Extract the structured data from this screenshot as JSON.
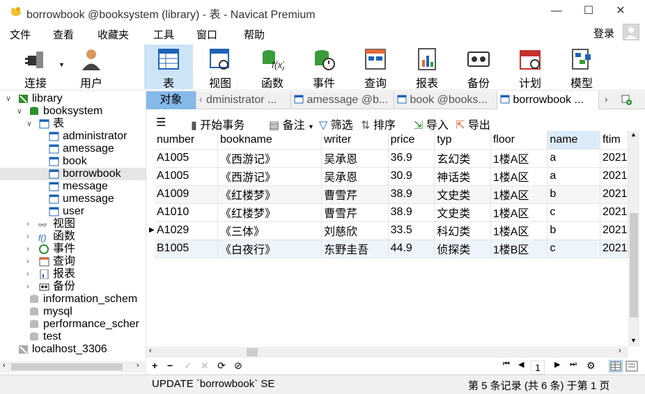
{
  "window": {
    "title": "borrowbook @booksystem (library) - 表 - Navicat Premium",
    "minimize": "—",
    "maximize": "☐",
    "close": "✕"
  },
  "menu": [
    "文件",
    "查看",
    "收藏夹",
    "工具",
    "窗口",
    "帮助"
  ],
  "login": "登录",
  "toolbar": [
    "连接",
    "用户",
    "表",
    "视图",
    "函数",
    "事件",
    "查询",
    "报表",
    "备份",
    "计划",
    "模型"
  ],
  "tree": {
    "connection": "library",
    "database": "booksystem",
    "tables_folder": "表",
    "tables": [
      "administrator",
      "amessage",
      "book",
      "borrowbook",
      "message",
      "umessage",
      "user"
    ],
    "folders": [
      "视图",
      "函数",
      "事件",
      "查询",
      "报表",
      "备份"
    ],
    "other_dbs": [
      "information_schem",
      "mysql",
      "performance_scher",
      "test"
    ],
    "other_connection": "localhost_3306"
  },
  "tabs": {
    "objects": "对象",
    "items": [
      "dministrator ...",
      "amessage @b...",
      "book @books...",
      "borrowbook ..."
    ]
  },
  "subtoolbar": {
    "begin": "开始事务",
    "note": "备注",
    "filter": "筛选",
    "sort": "排序",
    "import": "导入",
    "export": "导出"
  },
  "grid": {
    "columns": [
      "number",
      "bookname",
      "writer",
      "price",
      "typ",
      "floor",
      "name",
      "ftim"
    ],
    "rows": [
      [
        "A1005",
        "《西游记》",
        "吴承恩",
        "36.9",
        "玄幻类",
        "1楼A区",
        "a",
        "2021"
      ],
      [
        "A1005",
        "《西游记》",
        "吴承恩",
        "30.9",
        "神话类",
        "1楼A区",
        "a",
        "2021"
      ],
      [
        "A1009",
        "《红楼梦》",
        "曹雪芹",
        "38.9",
        "文史类",
        "1楼A区",
        "b",
        "2021"
      ],
      [
        "A1010",
        "《红楼梦》",
        "曹雪芹",
        "38.9",
        "文史类",
        "1楼A区",
        "c",
        "2021"
      ],
      [
        "A1029",
        "《三体》",
        "刘慈欣",
        "33.5",
        "科幻类",
        "1楼A区",
        "b",
        "2021"
      ],
      [
        "B1005",
        "《白夜行》",
        "东野圭吾",
        "44.9",
        "侦探类",
        "1楼B区",
        "c",
        "2021"
      ]
    ]
  },
  "navbar": {
    "add": "+",
    "remove": "−",
    "apply": "✓",
    "discard": "✕",
    "refresh": "⟳",
    "stop": "⊘",
    "first": "⏮",
    "prev": "◀",
    "page": "1",
    "next": "▶",
    "last": "⏭",
    "settings": "⚙"
  },
  "status": {
    "sql": "UPDATE `borrowbook` SE",
    "record": "第 5 条记录 (共 6 条) 于第 1 页"
  },
  "colors": {
    "accent": "#86b9e8",
    "active_tool": "#cde4f7",
    "header_hl": "#dcebf8"
  }
}
